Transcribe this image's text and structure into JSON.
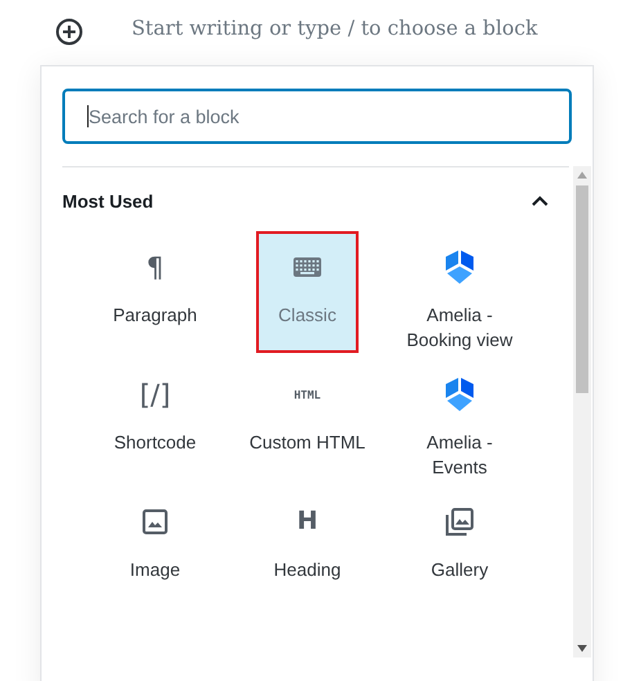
{
  "editor": {
    "placeholder": "Start writing or type / to choose a block"
  },
  "inserter": {
    "search": {
      "placeholder": "Search for a block",
      "focused": true
    },
    "section": {
      "title": "Most Used",
      "expanded": true
    },
    "blocks": [
      {
        "label": "Paragraph",
        "kind": "glyph",
        "glyph": "¶",
        "selected": false
      },
      {
        "label": "Classic",
        "kind": "keyboard",
        "selected": true
      },
      {
        "label": "Amelia - Booking view",
        "kind": "hexagon",
        "selected": false
      },
      {
        "label": "Shortcode",
        "kind": "glyph",
        "glyph": "[/]",
        "selected": false
      },
      {
        "label": "Custom HTML",
        "kind": "small-glyph",
        "glyph": "HTML",
        "selected": false
      },
      {
        "label": "Amelia - Events",
        "kind": "hexagon",
        "selected": false
      },
      {
        "label": "Image",
        "kind": "image",
        "selected": false
      },
      {
        "label": "Heading",
        "kind": "glyph",
        "glyph": "H",
        "selected": false
      },
      {
        "label": "Gallery",
        "kind": "gallery",
        "selected": false
      }
    ]
  }
}
